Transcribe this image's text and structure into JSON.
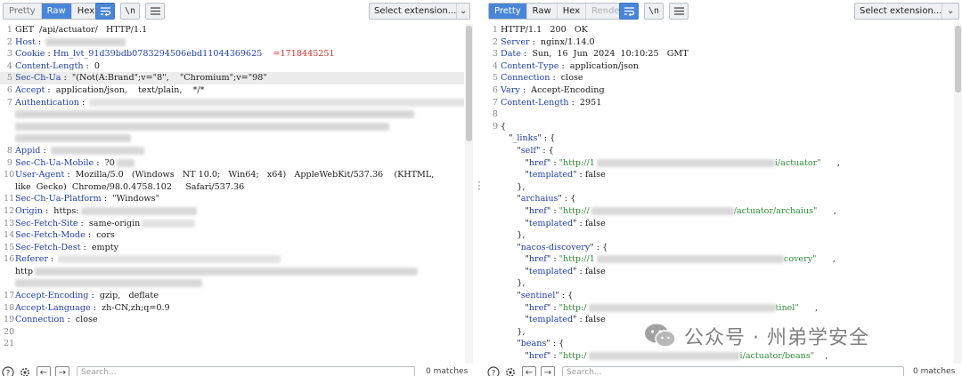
{
  "left": {
    "tabs": [
      "Pretty",
      "Raw",
      "Hex"
    ],
    "active_tab": "Raw",
    "wrap_label": "\\n",
    "select_extension": "Select extension...",
    "lines": [
      {
        "n": "1",
        "parts": [
          {
            "t": "GET  /api/actuator/   HTTP/1.1",
            "c": ""
          }
        ]
      },
      {
        "n": "2",
        "parts": [
          {
            "t": "Host",
            "c": "hk"
          },
          {
            "t": " : ",
            "c": ""
          }
        ]
      },
      {
        "n": "3",
        "parts": [
          {
            "t": "Cookie",
            "c": "hk"
          },
          {
            "t": " : ",
            "c": ""
          },
          {
            "t": "Hm_lvt_91d39bdb0783294506ebd11044369625",
            "c": "hk"
          },
          {
            "t": "    =1718445251",
            "c": "red"
          }
        ]
      },
      {
        "n": "4",
        "parts": [
          {
            "t": "Content-Length",
            "c": "hk"
          },
          {
            "t": " :  0",
            "c": ""
          }
        ]
      },
      {
        "n": "5",
        "parts": [
          {
            "t": "Sec-Ch-Ua",
            "c": "hk"
          },
          {
            "t": " :  \"(Not(A:Brand\";v=\"8\",    \"Chromium\";v=\"98\"",
            "c": ""
          }
        ]
      },
      {
        "n": "6",
        "parts": [
          {
            "t": "Accept",
            "c": "hk"
          },
          {
            "t": " :  application/json,    text/plain,    */*",
            "c": ""
          }
        ]
      },
      {
        "n": "7",
        "parts": [
          {
            "t": "Authentication",
            "c": "hk"
          },
          {
            "t": " : ",
            "c": ""
          }
        ]
      },
      {
        "n": "",
        "parts": []
      },
      {
        "n": "",
        "parts": []
      },
      {
        "n": "",
        "parts": []
      },
      {
        "n": "8",
        "parts": [
          {
            "t": "Appid",
            "c": "hk"
          },
          {
            "t": " : ",
            "c": ""
          }
        ]
      },
      {
        "n": "9",
        "parts": [
          {
            "t": "Sec-Ch-Ua-Mobile",
            "c": "hk"
          },
          {
            "t": " :  ?0",
            "c": ""
          }
        ]
      },
      {
        "n": "10",
        "parts": [
          {
            "t": "User-Agent",
            "c": "hk"
          },
          {
            "t": " :  Mozilla/5.0   (Windows   NT 10.0;   Win64;   x64)   AppleWebKit/537.36    (KHTML,",
            "c": ""
          }
        ]
      },
      {
        "n": "",
        "parts": [
          {
            "t": "like  Gecko)  Chrome/98.0.4758.102     Safari/537.36",
            "c": ""
          }
        ]
      },
      {
        "n": "11",
        "parts": [
          {
            "t": "Sec-Ch-Ua-Platform",
            "c": "hk"
          },
          {
            "t": " :  \"Windows\"",
            "c": ""
          }
        ]
      },
      {
        "n": "12",
        "parts": [
          {
            "t": "Origin",
            "c": "hk"
          },
          {
            "t": " :  https:",
            "c": ""
          }
        ]
      },
      {
        "n": "13",
        "parts": [
          {
            "t": "Sec-Fetch-Site",
            "c": "hk"
          },
          {
            "t": " :  same-origin",
            "c": ""
          }
        ]
      },
      {
        "n": "14",
        "parts": [
          {
            "t": "Sec-Fetch-Mode",
            "c": "hk"
          },
          {
            "t": " :  cors",
            "c": ""
          }
        ]
      },
      {
        "n": "15",
        "parts": [
          {
            "t": "Sec-Fetch-Dest",
            "c": "hk"
          },
          {
            "t": " :  empty",
            "c": ""
          }
        ]
      },
      {
        "n": "16",
        "parts": [
          {
            "t": "Referer",
            "c": "hk"
          },
          {
            "t": " : ",
            "c": ""
          }
        ]
      },
      {
        "n": "",
        "parts": [
          {
            "t": "http",
            "c": ""
          }
        ]
      },
      {
        "n": "",
        "parts": []
      },
      {
        "n": "17",
        "parts": [
          {
            "t": "Accept-Encoding",
            "c": "hk"
          },
          {
            "t": " :  gzip,   deflate",
            "c": ""
          }
        ]
      },
      {
        "n": "18",
        "parts": [
          {
            "t": "Accept-Language",
            "c": "hk"
          },
          {
            "t": " :  zh-CN,zh;q=0.9",
            "c": ""
          }
        ]
      },
      {
        "n": "19",
        "parts": [
          {
            "t": "Connection",
            "c": "hk"
          },
          {
            "t": " :  close",
            "c": ""
          }
        ]
      },
      {
        "n": "20",
        "parts": []
      },
      {
        "n": "21",
        "parts": []
      }
    ],
    "search_placeholder": "Search...",
    "matches": "0 matches"
  },
  "right": {
    "tabs": [
      "Pretty",
      "Raw",
      "Hex",
      "Render"
    ],
    "active_tab": "Pretty",
    "wrap_label": "\\n",
    "select_extension": "Select extension...",
    "lines": [
      {
        "n": "1",
        "parts": [
          {
            "t": "HTTP/1.1   200   OK",
            "c": ""
          }
        ]
      },
      {
        "n": "2",
        "parts": [
          {
            "t": "Server",
            "c": "hk"
          },
          {
            "t": " :  nginx/1.14.0",
            "c": ""
          }
        ]
      },
      {
        "n": "3",
        "parts": [
          {
            "t": "Date",
            "c": "hk"
          },
          {
            "t": " :  Sun,  16  Jun  2024  10:10:25   GMT",
            "c": ""
          }
        ]
      },
      {
        "n": "4",
        "parts": [
          {
            "t": "Content-Type",
            "c": "hk"
          },
          {
            "t": " :  application/json",
            "c": ""
          }
        ]
      },
      {
        "n": "5",
        "parts": [
          {
            "t": "Connection",
            "c": "hk"
          },
          {
            "t": " :  close",
            "c": ""
          }
        ]
      },
      {
        "n": "6",
        "parts": [
          {
            "t": "Vary",
            "c": "hk"
          },
          {
            "t": " :  Accept-Encoding",
            "c": ""
          }
        ]
      },
      {
        "n": "7",
        "parts": [
          {
            "t": "Content-Length",
            "c": "hk"
          },
          {
            "t": " :  2951",
            "c": ""
          }
        ]
      },
      {
        "n": "8",
        "parts": []
      },
      {
        "n": "9",
        "parts": [
          {
            "t": "{",
            "c": ""
          }
        ]
      },
      {
        "n": "",
        "parts": [
          {
            "t": "   \"",
            "c": ""
          },
          {
            "t": "_links",
            "c": "jk"
          },
          {
            "t": "\" : {",
            "c": ""
          }
        ]
      },
      {
        "n": "",
        "parts": [
          {
            "t": "      \"",
            "c": ""
          },
          {
            "t": "self",
            "c": "jk"
          },
          {
            "t": "\" : {",
            "c": ""
          }
        ]
      },
      {
        "n": "",
        "parts": [
          {
            "t": "         \"",
            "c": ""
          },
          {
            "t": "href",
            "c": "jk"
          },
          {
            "t": "\" : ",
            "c": ""
          },
          {
            "t": "\"http://1",
            "c": "js"
          }
        ]
      },
      {
        "n": "",
        "parts": [
          {
            "t": "         \"",
            "c": ""
          },
          {
            "t": "templated",
            "c": "jk"
          },
          {
            "t": "\" : false",
            "c": ""
          }
        ]
      },
      {
        "n": "",
        "parts": [
          {
            "t": "      },",
            "c": ""
          }
        ]
      },
      {
        "n": "",
        "parts": [
          {
            "t": "      \"",
            "c": ""
          },
          {
            "t": "archaius",
            "c": "jk"
          },
          {
            "t": "\" : {",
            "c": ""
          }
        ]
      },
      {
        "n": "",
        "parts": [
          {
            "t": "         \"",
            "c": ""
          },
          {
            "t": "href",
            "c": "jk"
          },
          {
            "t": "\" : ",
            "c": ""
          },
          {
            "t": "\"http://",
            "c": "js"
          }
        ]
      },
      {
        "n": "",
        "parts": [
          {
            "t": "         \"",
            "c": ""
          },
          {
            "t": "templated",
            "c": "jk"
          },
          {
            "t": "\" : false",
            "c": ""
          }
        ]
      },
      {
        "n": "",
        "parts": [
          {
            "t": "      },",
            "c": ""
          }
        ]
      },
      {
        "n": "",
        "parts": [
          {
            "t": "      \"",
            "c": ""
          },
          {
            "t": "nacos-discovery",
            "c": "jk"
          },
          {
            "t": "\" : {",
            "c": ""
          }
        ]
      },
      {
        "n": "",
        "parts": [
          {
            "t": "         \"",
            "c": ""
          },
          {
            "t": "href",
            "c": "jk"
          },
          {
            "t": "\" : ",
            "c": ""
          },
          {
            "t": "\"http://1",
            "c": "js"
          }
        ]
      },
      {
        "n": "",
        "parts": [
          {
            "t": "         \"",
            "c": ""
          },
          {
            "t": "templated",
            "c": "jk"
          },
          {
            "t": "\" : false",
            "c": ""
          }
        ]
      },
      {
        "n": "",
        "parts": [
          {
            "t": "      },",
            "c": ""
          }
        ]
      },
      {
        "n": "",
        "parts": [
          {
            "t": "      \"",
            "c": ""
          },
          {
            "t": "sentinel",
            "c": "jk"
          },
          {
            "t": "\" : {",
            "c": ""
          }
        ]
      },
      {
        "n": "",
        "parts": [
          {
            "t": "         \"",
            "c": ""
          },
          {
            "t": "href",
            "c": "jk"
          },
          {
            "t": "\" : ",
            "c": ""
          },
          {
            "t": "\"http:/",
            "c": "js"
          }
        ]
      },
      {
        "n": "",
        "parts": [
          {
            "t": "         \"",
            "c": ""
          },
          {
            "t": "templated",
            "c": "jk"
          },
          {
            "t": "\" : false",
            "c": ""
          }
        ]
      },
      {
        "n": "",
        "parts": [
          {
            "t": "      },",
            "c": ""
          }
        ]
      },
      {
        "n": "",
        "parts": [
          {
            "t": "      \"",
            "c": ""
          },
          {
            "t": "beans",
            "c": "jk"
          },
          {
            "t": "\" : {",
            "c": ""
          }
        ]
      },
      {
        "n": "",
        "parts": [
          {
            "t": "         \"",
            "c": ""
          },
          {
            "t": "href",
            "c": "jk"
          },
          {
            "t": "\" : ",
            "c": ""
          },
          {
            "t": "\"http:/",
            "c": "js"
          }
        ]
      }
    ],
    "href_tails": [
      {
        "line": 11,
        "text": "i/actuator\"",
        "after": "      ,"
      },
      {
        "line": 15,
        "text": "/actuator/archaius\"",
        "after": "      ,"
      },
      {
        "line": 19,
        "text": "covery\"",
        "after": "      ,"
      },
      {
        "line": 23,
        "text": "tinel\"",
        "after": "      ,"
      },
      {
        "line": 27,
        "text": "i/actuator/beans\"",
        "after": "    ,"
      }
    ],
    "search_placeholder": "Search...",
    "matches": "0 matches"
  },
  "watermark": "公众号 · 州弟学安全",
  "colors": {
    "active_tab": "#4a86d8",
    "header_key": "#1f3fa8",
    "json_string": "#2c8c35",
    "cookie_value": "#d12a2a"
  },
  "icons": [
    "wrap-lines-icon",
    "newline-icon",
    "menu-icon",
    "chevron-down-icon",
    "help-icon",
    "settings-icon",
    "back-arrow-icon",
    "forward-arrow-icon",
    "wechat-logo-icon"
  ]
}
